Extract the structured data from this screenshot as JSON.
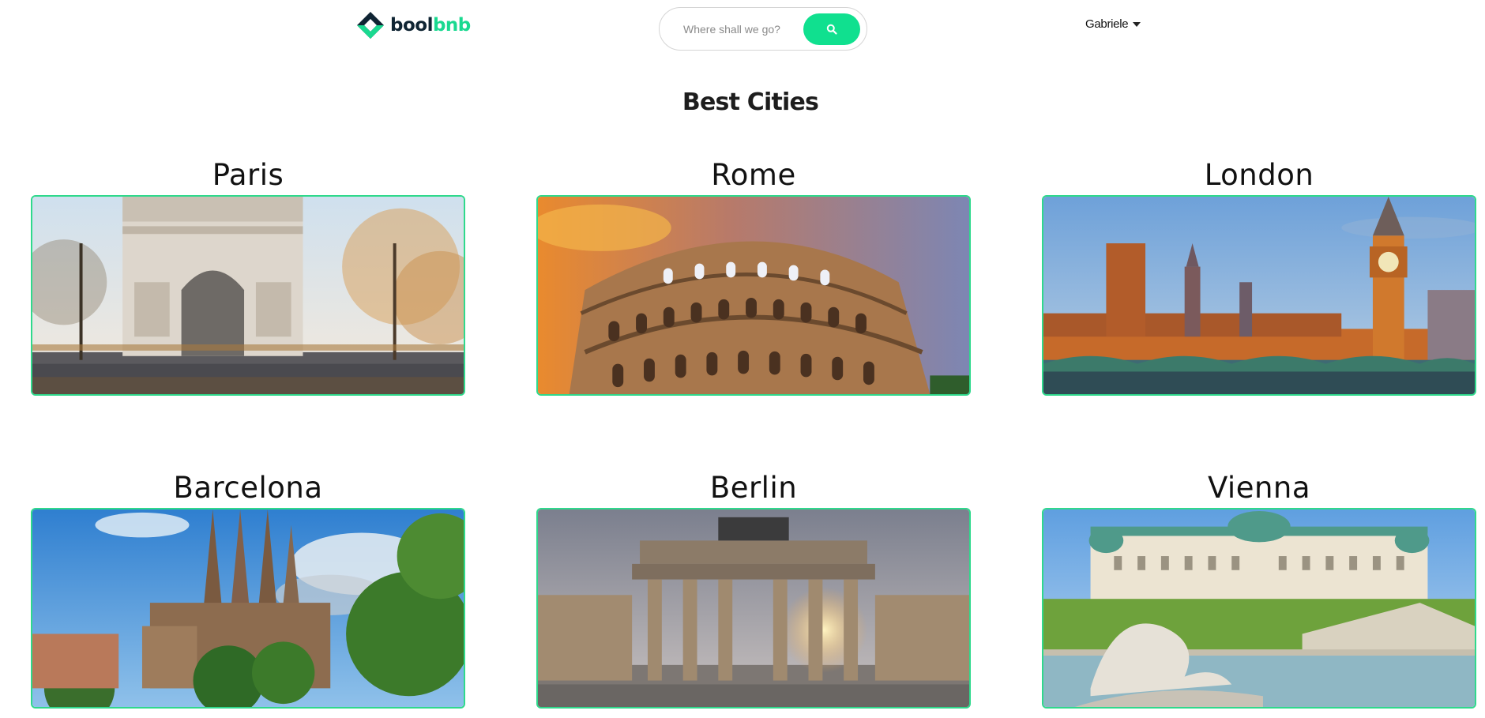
{
  "brand": {
    "name_part1": "bool",
    "name_part2": "bnb",
    "colors": {
      "dark": "#0f2433",
      "accent": "#1ad990"
    }
  },
  "search": {
    "placeholder": "Where shall we go?",
    "value": "",
    "button_icon": "search-icon"
  },
  "user": {
    "name": "Gabriele",
    "menu_icon": "caret-down-icon"
  },
  "section": {
    "title": "Best Cities"
  },
  "cities": [
    {
      "name": "Paris",
      "image": "arc-de-triomphe-photo"
    },
    {
      "name": "Rome",
      "image": "colosseum-photo"
    },
    {
      "name": "London",
      "image": "westminster-big-ben-photo"
    },
    {
      "name": "Barcelona",
      "image": "sagrada-familia-photo"
    },
    {
      "name": "Berlin",
      "image": "brandenburg-gate-photo"
    },
    {
      "name": "Vienna",
      "image": "belvedere-palace-photo"
    }
  ],
  "colors": {
    "card_border": "#2fd98c",
    "search_button": "#10e08f"
  }
}
